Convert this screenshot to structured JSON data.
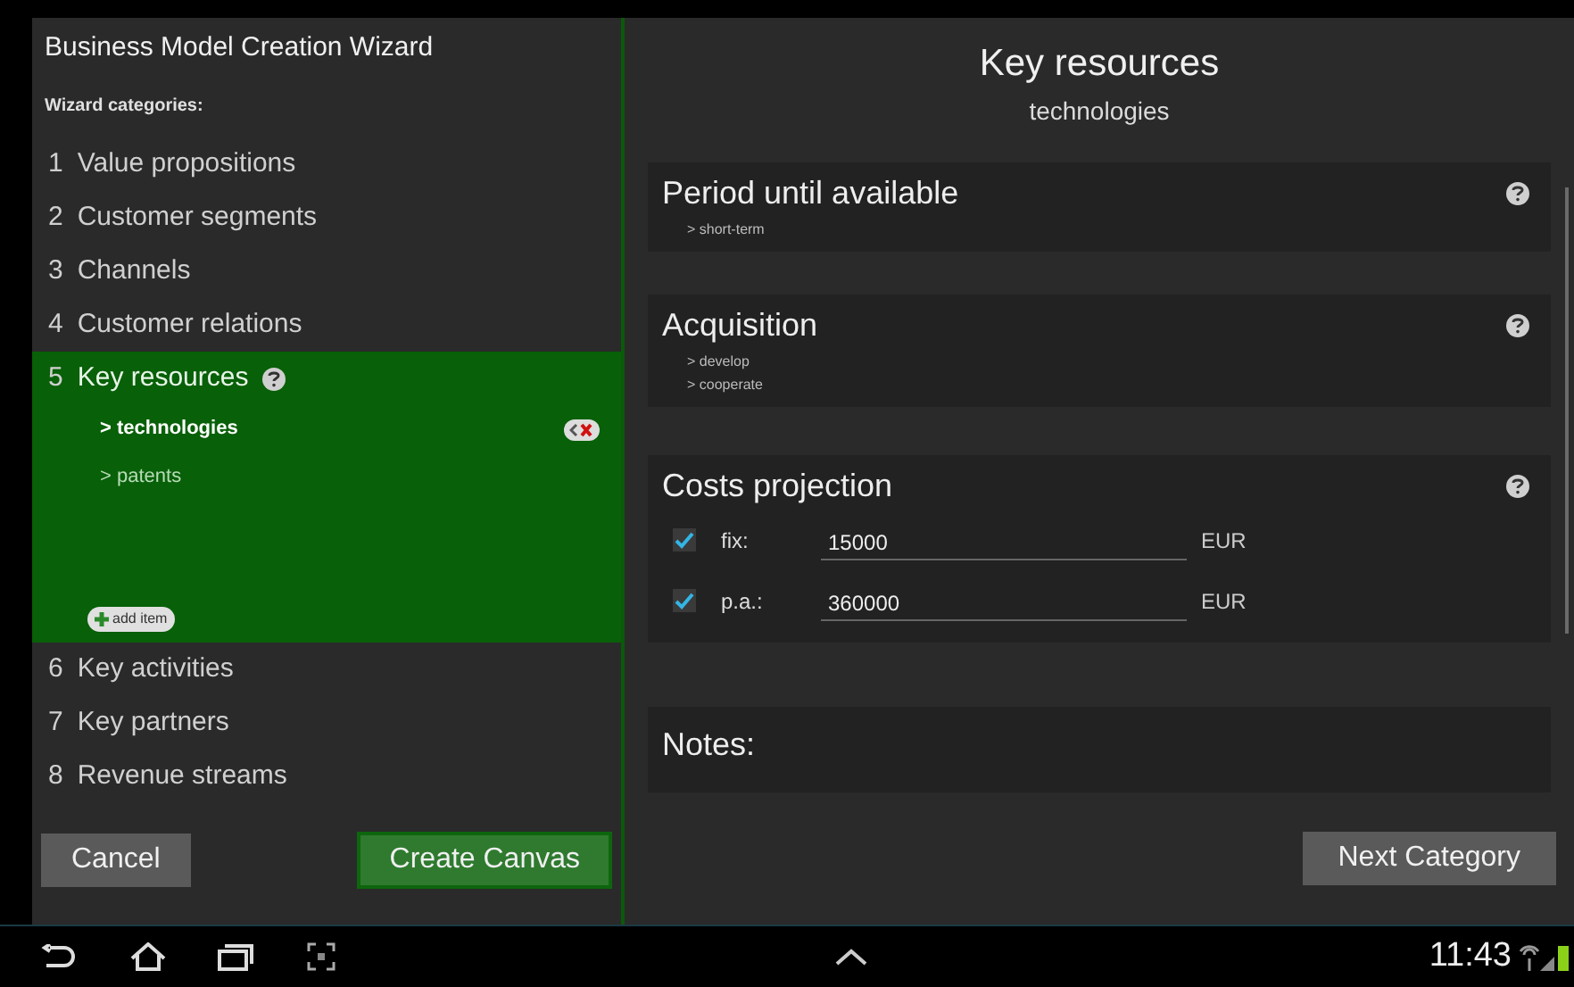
{
  "wizard": {
    "title": "Business Model Creation Wizard",
    "categories_label": "Wizard categories:",
    "categories": [
      {
        "number": "1",
        "label": "Value propositions",
        "selected": false
      },
      {
        "number": "2",
        "label": "Customer segments",
        "selected": false
      },
      {
        "number": "3",
        "label": "Channels",
        "selected": false
      },
      {
        "number": "4",
        "label": "Customer relations",
        "selected": false
      },
      {
        "number": "5",
        "label": "Key resources",
        "selected": true,
        "help": true,
        "items": [
          {
            "label": "> technologies",
            "selected": true
          },
          {
            "label": "> patents",
            "selected": false
          }
        ],
        "add_button": "add item"
      },
      {
        "number": "6",
        "label": "Key activities",
        "selected": false
      },
      {
        "number": "7",
        "label": "Key partners",
        "selected": false
      },
      {
        "number": "8",
        "label": "Revenue streams",
        "selected": false
      }
    ],
    "buttons": [
      {
        "label": "Cancel",
        "kind": "secondary"
      },
      {
        "label": "Create Canvas",
        "kind": "primary"
      }
    ]
  },
  "detail": {
    "title": "Key resources",
    "subtitle": "technologies",
    "sections": [
      {
        "kind": "options",
        "title": "Period until available",
        "help": true,
        "options": [
          "> short-term"
        ]
      },
      {
        "kind": "options",
        "title": "Acquisition",
        "help": true,
        "options": [
          "> develop",
          "> cooperate"
        ]
      },
      {
        "kind": "costs",
        "title": "Costs projection",
        "help": true,
        "rows": [
          {
            "label": "fix:",
            "checked": true,
            "value": "15000",
            "unit": "EUR"
          },
          {
            "label": "p.a.:",
            "checked": true,
            "value": "360000",
            "unit": "EUR"
          }
        ]
      },
      {
        "kind": "notes",
        "title": "Notes:",
        "help": false
      }
    ],
    "next_button": "Next Category"
  },
  "status_bar": {
    "time": "11:43"
  }
}
